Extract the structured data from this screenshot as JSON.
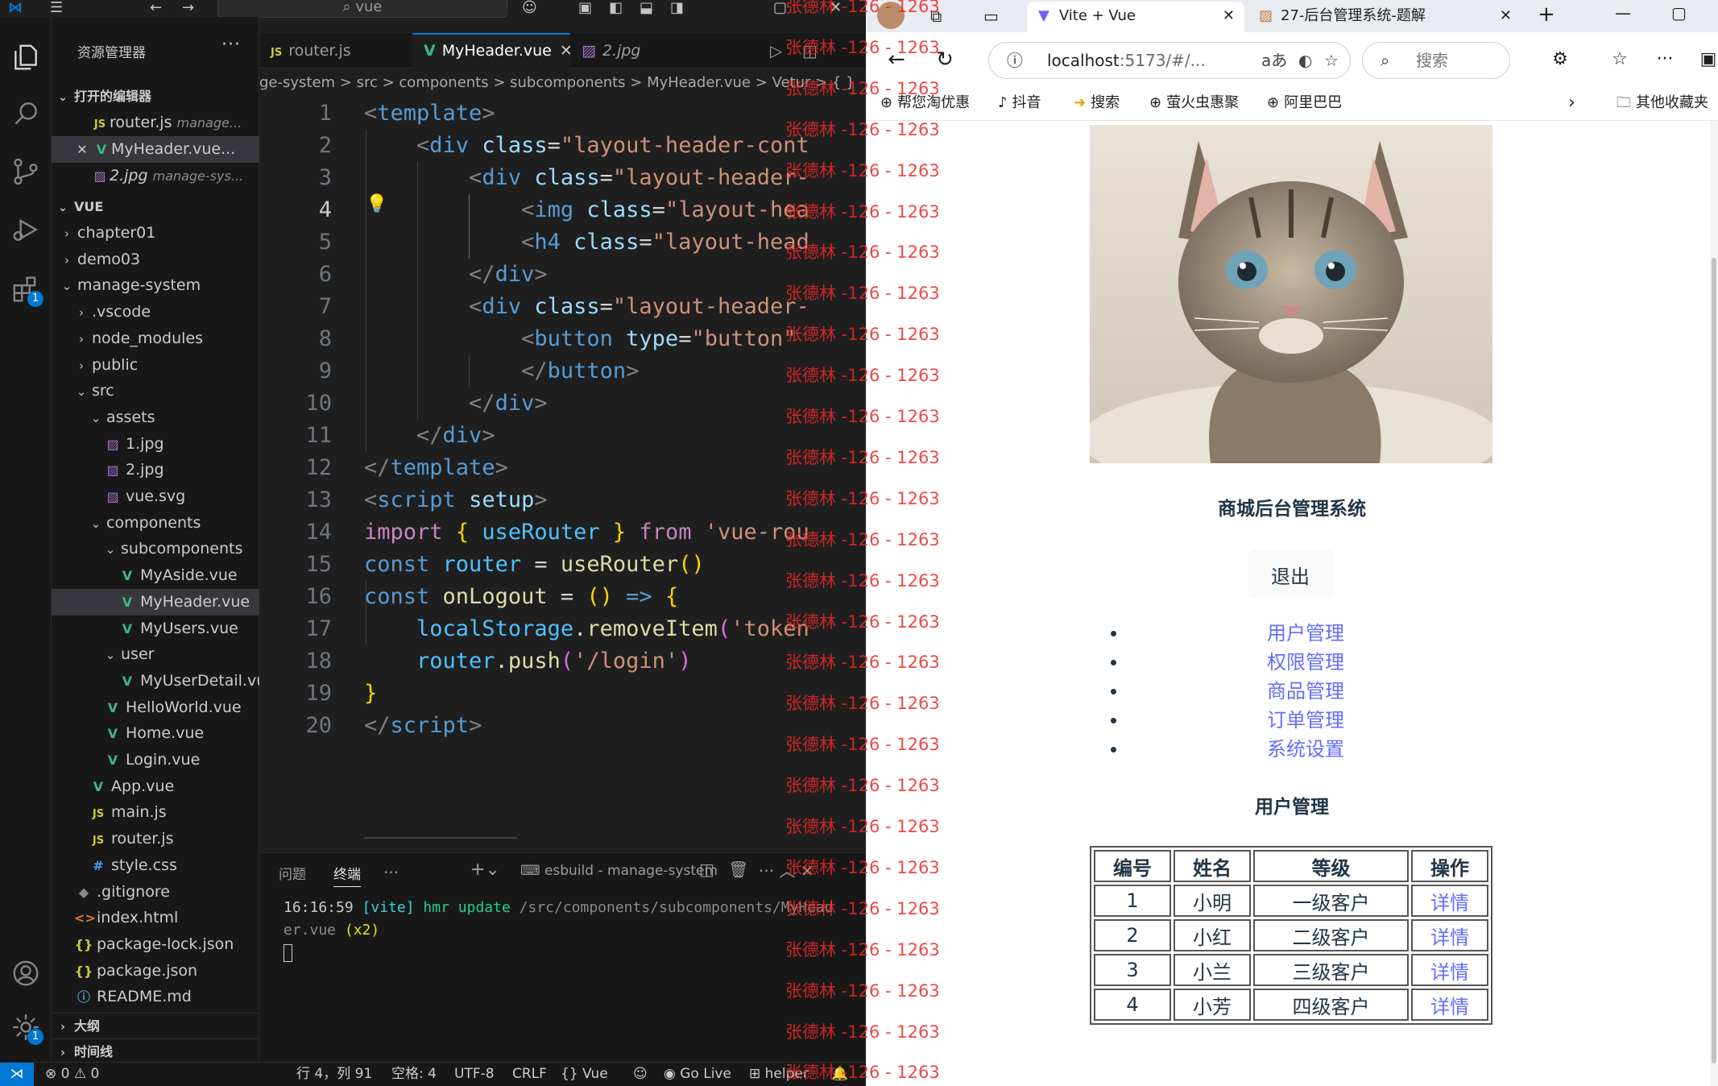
{
  "vscode": {
    "search_text": "vue",
    "explorer_title": "资源管理器",
    "open_editors_title": "打开的编辑器",
    "open_editors": [
      {
        "name": "router.js",
        "desc": "manage...",
        "icon": "js"
      },
      {
        "name": "MyHeader.vue...",
        "desc": "",
        "icon": "vue"
      },
      {
        "name": "2.jpg",
        "desc": "manage-sys...",
        "icon": "img"
      }
    ],
    "workspace_title": "VUE",
    "tree": [
      {
        "name": "chapter01",
        "type": "folder",
        "depth": 0,
        "open": false
      },
      {
        "name": "demo03",
        "type": "folder",
        "depth": 0,
        "open": false
      },
      {
        "name": "manage-system",
        "type": "folder",
        "depth": 0,
        "open": true
      },
      {
        "name": ".vscode",
        "type": "folder",
        "depth": 1,
        "open": false
      },
      {
        "name": "node_modules",
        "type": "folder",
        "depth": 1,
        "open": false
      },
      {
        "name": "public",
        "type": "folder",
        "depth": 1,
        "open": false
      },
      {
        "name": "src",
        "type": "folder",
        "depth": 1,
        "open": true
      },
      {
        "name": "assets",
        "type": "folder",
        "depth": 2,
        "open": true
      },
      {
        "name": "1.jpg",
        "type": "img",
        "depth": 3
      },
      {
        "name": "2.jpg",
        "type": "img",
        "depth": 3
      },
      {
        "name": "vue.svg",
        "type": "img",
        "depth": 3
      },
      {
        "name": "components",
        "type": "folder",
        "depth": 2,
        "open": true
      },
      {
        "name": "subcomponents",
        "type": "folder",
        "depth": 3,
        "open": true
      },
      {
        "name": "MyAside.vue",
        "type": "vue",
        "depth": 4
      },
      {
        "name": "MyHeader.vue",
        "type": "vue",
        "depth": 4,
        "selected": true
      },
      {
        "name": "MyUsers.vue",
        "type": "vue",
        "depth": 4
      },
      {
        "name": "user",
        "type": "folder",
        "depth": 3,
        "open": true
      },
      {
        "name": "MyUserDetail.vue",
        "type": "vue",
        "depth": 4
      },
      {
        "name": "HelloWorld.vue",
        "type": "vue",
        "depth": 3
      },
      {
        "name": "Home.vue",
        "type": "vue",
        "depth": 3
      },
      {
        "name": "Login.vue",
        "type": "vue",
        "depth": 3
      },
      {
        "name": "App.vue",
        "type": "vue",
        "depth": 2
      },
      {
        "name": "main.js",
        "type": "js",
        "depth": 2
      },
      {
        "name": "router.js",
        "type": "js",
        "depth": 2
      },
      {
        "name": "style.css",
        "type": "css",
        "depth": 2
      },
      {
        "name": ".gitignore",
        "type": "git",
        "depth": 1
      },
      {
        "name": "index.html",
        "type": "html",
        "depth": 1
      },
      {
        "name": "package-lock.json",
        "type": "json",
        "depth": 1
      },
      {
        "name": "package.json",
        "type": "json",
        "depth": 1
      },
      {
        "name": "README.md",
        "type": "info",
        "depth": 1
      }
    ],
    "outline_title": "大纲",
    "timeline_title": "时间线",
    "tabs": [
      {
        "name": "router.js",
        "icon": "js"
      },
      {
        "name": "MyHeader.vue",
        "icon": "vue",
        "active": true
      },
      {
        "name": "2.jpg",
        "icon": "img"
      }
    ],
    "breadcrumb": "ge-system > src > components > subcomponents > MyHeader.vue > Vetur > { }",
    "current_line": 4,
    "code": [
      [
        [
          "br",
          "<"
        ],
        [
          "tag",
          "template"
        ],
        [
          "br",
          ">"
        ]
      ],
      [
        [
          "pl",
          "    "
        ],
        [
          "br",
          "<"
        ],
        [
          "tag",
          "div"
        ],
        [
          "pl",
          " "
        ],
        [
          "attr",
          "class"
        ],
        [
          "pl",
          "="
        ],
        [
          "str",
          "\"layout-header-cont"
        ]
      ],
      [
        [
          "pl",
          "        "
        ],
        [
          "br",
          "<"
        ],
        [
          "tag",
          "div"
        ],
        [
          "pl",
          " "
        ],
        [
          "attr",
          "class"
        ],
        [
          "pl",
          "="
        ],
        [
          "str",
          "\"layout-header-"
        ]
      ],
      [
        [
          "pl",
          "            "
        ],
        [
          "br",
          "<"
        ],
        [
          "tag",
          "img"
        ],
        [
          "pl",
          " "
        ],
        [
          "attr",
          "class"
        ],
        [
          "pl",
          "="
        ],
        [
          "str",
          "\"layout-hea"
        ]
      ],
      [
        [
          "pl",
          "            "
        ],
        [
          "br",
          "<"
        ],
        [
          "tag",
          "h4"
        ],
        [
          "pl",
          " "
        ],
        [
          "attr",
          "class"
        ],
        [
          "pl",
          "="
        ],
        [
          "str",
          "\"layout-head"
        ]
      ],
      [
        [
          "pl",
          "        "
        ],
        [
          "br",
          "</"
        ],
        [
          "tag",
          "div"
        ],
        [
          "br",
          ">"
        ]
      ],
      [
        [
          "pl",
          "        "
        ],
        [
          "br",
          "<"
        ],
        [
          "tag",
          "div"
        ],
        [
          "pl",
          " "
        ],
        [
          "attr",
          "class"
        ],
        [
          "pl",
          "="
        ],
        [
          "str",
          "\"layout-header-"
        ]
      ],
      [
        [
          "pl",
          "            "
        ],
        [
          "br",
          "<"
        ],
        [
          "tag",
          "button"
        ],
        [
          "pl",
          " "
        ],
        [
          "attr",
          "type"
        ],
        [
          "pl",
          "="
        ],
        [
          "str",
          "\"button\""
        ]
      ],
      [
        [
          "pl",
          "            "
        ],
        [
          "br",
          "</"
        ],
        [
          "tag",
          "button"
        ],
        [
          "br",
          ">"
        ]
      ],
      [
        [
          "pl",
          "        "
        ],
        [
          "br",
          "</"
        ],
        [
          "tag",
          "div"
        ],
        [
          "br",
          ">"
        ]
      ],
      [
        [
          "pl",
          "    "
        ],
        [
          "br",
          "</"
        ],
        [
          "tag",
          "div"
        ],
        [
          "br",
          ">"
        ]
      ],
      [
        [
          "br",
          "</"
        ],
        [
          "tag",
          "template"
        ],
        [
          "br",
          ">"
        ]
      ],
      [
        [
          "br",
          "<"
        ],
        [
          "tag",
          "script"
        ],
        [
          "pl",
          " "
        ],
        [
          "attr",
          "setup"
        ],
        [
          "br",
          ">"
        ]
      ],
      [
        [
          "kw",
          "import"
        ],
        [
          "pl",
          " "
        ],
        [
          "p1",
          "{"
        ],
        [
          "pl",
          " "
        ],
        [
          "var",
          "useRouter"
        ],
        [
          "pl",
          " "
        ],
        [
          "p1",
          "}"
        ],
        [
          "pl",
          " "
        ],
        [
          "kw",
          "from"
        ],
        [
          "pl",
          " "
        ],
        [
          "str",
          "'vue-rou"
        ]
      ],
      [
        [
          "decl",
          "const"
        ],
        [
          "pl",
          " "
        ],
        [
          "var",
          "router"
        ],
        [
          "pl",
          " = "
        ],
        [
          "fn",
          "useRouter"
        ],
        [
          "p1",
          "()"
        ]
      ],
      [
        [
          "decl",
          "const"
        ],
        [
          "pl",
          " "
        ],
        [
          "fn",
          "onLogout"
        ],
        [
          "pl",
          " = "
        ],
        [
          "p1",
          "()"
        ],
        [
          "pl",
          " "
        ],
        [
          "decl",
          "=>"
        ],
        [
          "pl",
          " "
        ],
        [
          "p1",
          "{"
        ]
      ],
      [
        [
          "pl",
          "    "
        ],
        [
          "var",
          "localStorage"
        ],
        [
          "pl",
          "."
        ],
        [
          "fn",
          "removeItem"
        ],
        [
          "p2",
          "("
        ],
        [
          "str",
          "'token"
        ]
      ],
      [
        [
          "pl",
          "    "
        ],
        [
          "var",
          "router"
        ],
        [
          "pl",
          "."
        ],
        [
          "fn",
          "push"
        ],
        [
          "p2",
          "("
        ],
        [
          "str",
          "'/login'"
        ],
        [
          "p2",
          ")"
        ]
      ],
      [
        [
          "p1",
          "}"
        ]
      ],
      [
        [
          "br",
          "</"
        ],
        [
          "tag",
          "script"
        ],
        [
          "br",
          ">"
        ]
      ]
    ],
    "panel_tabs": [
      "问题",
      "终端"
    ],
    "panel_more": "···",
    "terminal_name": "esbuild - manage-system",
    "terminal": {
      "time": "16:16:59",
      "tag": "[vite]",
      "action": "hmr update",
      "path": "/src/components/subcomponents/MyHead",
      "path2": "er.vue",
      "count": "(x2)"
    },
    "status": {
      "errors": "0",
      "warnings": "0",
      "position": "行 4，列 91",
      "spaces": "空格: 4",
      "encoding": "UTF-8",
      "eol": "CRLF",
      "language": "Vue",
      "golive": "Go Live",
      "helper": "helper"
    },
    "badges": {
      "extensions": "1",
      "settings": "1"
    }
  },
  "browser": {
    "tabs": [
      {
        "title": "Vite + Vue",
        "active": true
      },
      {
        "title": "27-后台管理系统-题解",
        "active": false
      }
    ],
    "url_host": "localhost",
    "url_path": ":5173/#/...",
    "search_placeholder": "搜索",
    "bookmarks": [
      "帮您淘优惠",
      "抖音",
      "搜索",
      "萤火虫惠聚",
      "阿里巴巴"
    ],
    "other_bookmarks": "其他收藏夹",
    "page": {
      "site_title": "商城后台管理系统",
      "logout_label": "退出",
      "menu": [
        "用户管理",
        "权限管理",
        "商品管理",
        "订单管理",
        "系统设置"
      ],
      "section_title": "用户管理",
      "table": {
        "headers": [
          "编号",
          "姓名",
          "等级",
          "操作"
        ],
        "rows": [
          [
            "1",
            "小明",
            "一级客户",
            "详情"
          ],
          [
            "2",
            "小红",
            "二级客户",
            "详情"
          ],
          [
            "3",
            "小兰",
            "三级客户",
            "详情"
          ],
          [
            "4",
            "小芳",
            "四级客户",
            "详情"
          ]
        ]
      }
    }
  },
  "watermark": {
    "text": "张德林 -126 - 1263",
    "color": "#ec2828"
  }
}
